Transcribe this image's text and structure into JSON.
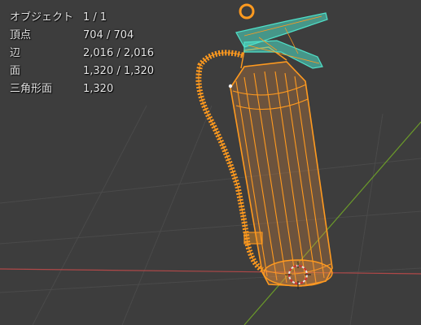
{
  "viewport": {
    "background": "#3d3d3d",
    "grid_color": "#4a4a4a",
    "x_axis_color": "#b04848",
    "y_axis_color": "#6b9a2a",
    "wire_color": "#ff9a1f",
    "selected_handle_color": "#4fe0c8",
    "object": "fire-extinguisher"
  },
  "stats": [
    {
      "label": "オブジェクト",
      "value": "1 / 1"
    },
    {
      "label": "頂点",
      "value": "704 / 704"
    },
    {
      "label": "辺",
      "value": "2,016 / 2,016"
    },
    {
      "label": "面",
      "value": "1,320 / 1,320"
    },
    {
      "label": "三角形面",
      "value": "1,320"
    }
  ]
}
